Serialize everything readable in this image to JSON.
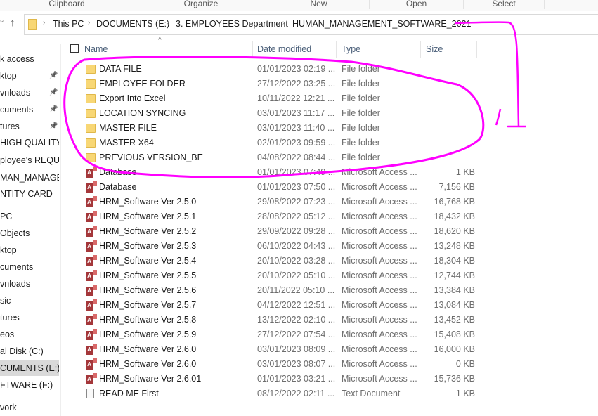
{
  "ribbon": {
    "groups": [
      "Clipboard",
      "Organize",
      "New",
      "Open",
      "Select"
    ]
  },
  "address": {
    "crumbs": [
      "This PC",
      "DOCUMENTS (E:)",
      "3. EMPLOYEES Department",
      "HUMAN_MANAGEMENT_SOFTWARE_2021"
    ]
  },
  "sidebar": {
    "items": [
      {
        "label": "k access"
      },
      {
        "label": "ktop",
        "pinned": true
      },
      {
        "label": "vnloads",
        "pinned": true
      },
      {
        "label": "cuments",
        "pinned": true
      },
      {
        "label": "tures",
        "pinned": true
      },
      {
        "label": "HIGH QUALITY O"
      },
      {
        "label": "ployee's REQUES"
      },
      {
        "label": "MAN_MANAGEI"
      },
      {
        "label": "NTITY CARD"
      },
      {
        "label": "PC"
      },
      {
        "label": "Objects"
      },
      {
        "label": "ktop"
      },
      {
        "label": "cuments"
      },
      {
        "label": "vnloads"
      },
      {
        "label": "sic"
      },
      {
        "label": "tures"
      },
      {
        "label": "eos"
      },
      {
        "label": "al Disk (C:)"
      },
      {
        "label": "CUMENTS (E:)",
        "selected": true
      },
      {
        "label": "FTWARE (F:)"
      },
      {
        "label": "vork"
      }
    ]
  },
  "columns": {
    "name": "Name",
    "date": "Date modified",
    "type": "Type",
    "size": "Size"
  },
  "files": [
    {
      "icon": "folder",
      "name": "DATA FILE",
      "date": "01/01/2023 02:19 ...",
      "type": "File folder",
      "size": ""
    },
    {
      "icon": "folder",
      "name": "EMPLOYEE FOLDER",
      "date": "27/12/2022 03:25 ...",
      "type": "File folder",
      "size": ""
    },
    {
      "icon": "folder",
      "name": "Export Into Excel",
      "date": "10/11/2022 12:21 ...",
      "type": "File folder",
      "size": ""
    },
    {
      "icon": "folder",
      "name": "LOCATION SYNCING",
      "date": "03/01/2023 11:17 ...",
      "type": "File folder",
      "size": ""
    },
    {
      "icon": "folder",
      "name": "MASTER FILE",
      "date": "03/01/2023 11:40 ...",
      "type": "File folder",
      "size": ""
    },
    {
      "icon": "folder",
      "name": "MASTER X64",
      "date": "02/01/2023 09:59 ...",
      "type": "File folder",
      "size": ""
    },
    {
      "icon": "folder",
      "name": "PREVIOUS VERSION_BE",
      "date": "04/08/2022 08:44 ...",
      "type": "File folder",
      "size": ""
    },
    {
      "icon": "access",
      "name": "Database",
      "date": "01/01/2023 07:49 ...",
      "type": "Microsoft Access ...",
      "size": "1 KB"
    },
    {
      "icon": "access",
      "name": "Database",
      "date": "01/01/2023 07:50 ...",
      "type": "Microsoft Access ...",
      "size": "7,156 KB"
    },
    {
      "icon": "access",
      "name": "HRM_Software Ver 2.5.0",
      "date": "29/08/2022 07:23 ...",
      "type": "Microsoft Access ...",
      "size": "16,768 KB"
    },
    {
      "icon": "access",
      "name": "HRM_Software Ver 2.5.1",
      "date": "28/08/2022 05:12 ...",
      "type": "Microsoft Access ...",
      "size": "18,432 KB"
    },
    {
      "icon": "access",
      "name": "HRM_Software Ver 2.5.2",
      "date": "29/09/2022 09:28 ...",
      "type": "Microsoft Access ...",
      "size": "18,620 KB"
    },
    {
      "icon": "access",
      "name": "HRM_Software Ver 2.5.3",
      "date": "06/10/2022 04:43 ...",
      "type": "Microsoft Access ...",
      "size": "13,248 KB"
    },
    {
      "icon": "access",
      "name": "HRM_Software Ver 2.5.4",
      "date": "20/10/2022 03:28 ...",
      "type": "Microsoft Access ...",
      "size": "18,304 KB"
    },
    {
      "icon": "access",
      "name": "HRM_Software Ver 2.5.5",
      "date": "20/10/2022 05:10 ...",
      "type": "Microsoft Access ...",
      "size": "12,744 KB"
    },
    {
      "icon": "access",
      "name": "HRM_Software Ver 2.5.6",
      "date": "20/11/2022 05:10 ...",
      "type": "Microsoft Access ...",
      "size": "13,384 KB"
    },
    {
      "icon": "access",
      "name": "HRM_Software Ver 2.5.7",
      "date": "04/12/2022 12:51 ...",
      "type": "Microsoft Access ...",
      "size": "13,084 KB"
    },
    {
      "icon": "access",
      "name": "HRM_Software Ver 2.5.8",
      "date": "13/12/2022 02:10 ...",
      "type": "Microsoft Access ...",
      "size": "13,452 KB"
    },
    {
      "icon": "access",
      "name": "HRM_Software Ver 2.5.9",
      "date": "27/12/2022 07:54 ...",
      "type": "Microsoft Access ...",
      "size": "15,408 KB"
    },
    {
      "icon": "access",
      "name": "HRM_Software Ver 2.6.0",
      "date": "03/01/2023 08:09 ...",
      "type": "Microsoft Access ...",
      "size": "16,000 KB"
    },
    {
      "icon": "access",
      "name": "HRM_Software Ver 2.6.0",
      "date": "03/01/2023 08:07 ...",
      "type": "Microsoft Access ...",
      "size": "0 KB"
    },
    {
      "icon": "access",
      "name": "HRM_Software Ver 2.6.01",
      "date": "01/01/2023 03:21 ...",
      "type": "Microsoft Access ...",
      "size": "15,736 KB"
    },
    {
      "icon": "text",
      "name": "READ ME First",
      "date": "08/12/2022 02:11 ...",
      "type": "Text Document",
      "size": "1 KB"
    }
  ],
  "annotation_color": "#ff00ff"
}
